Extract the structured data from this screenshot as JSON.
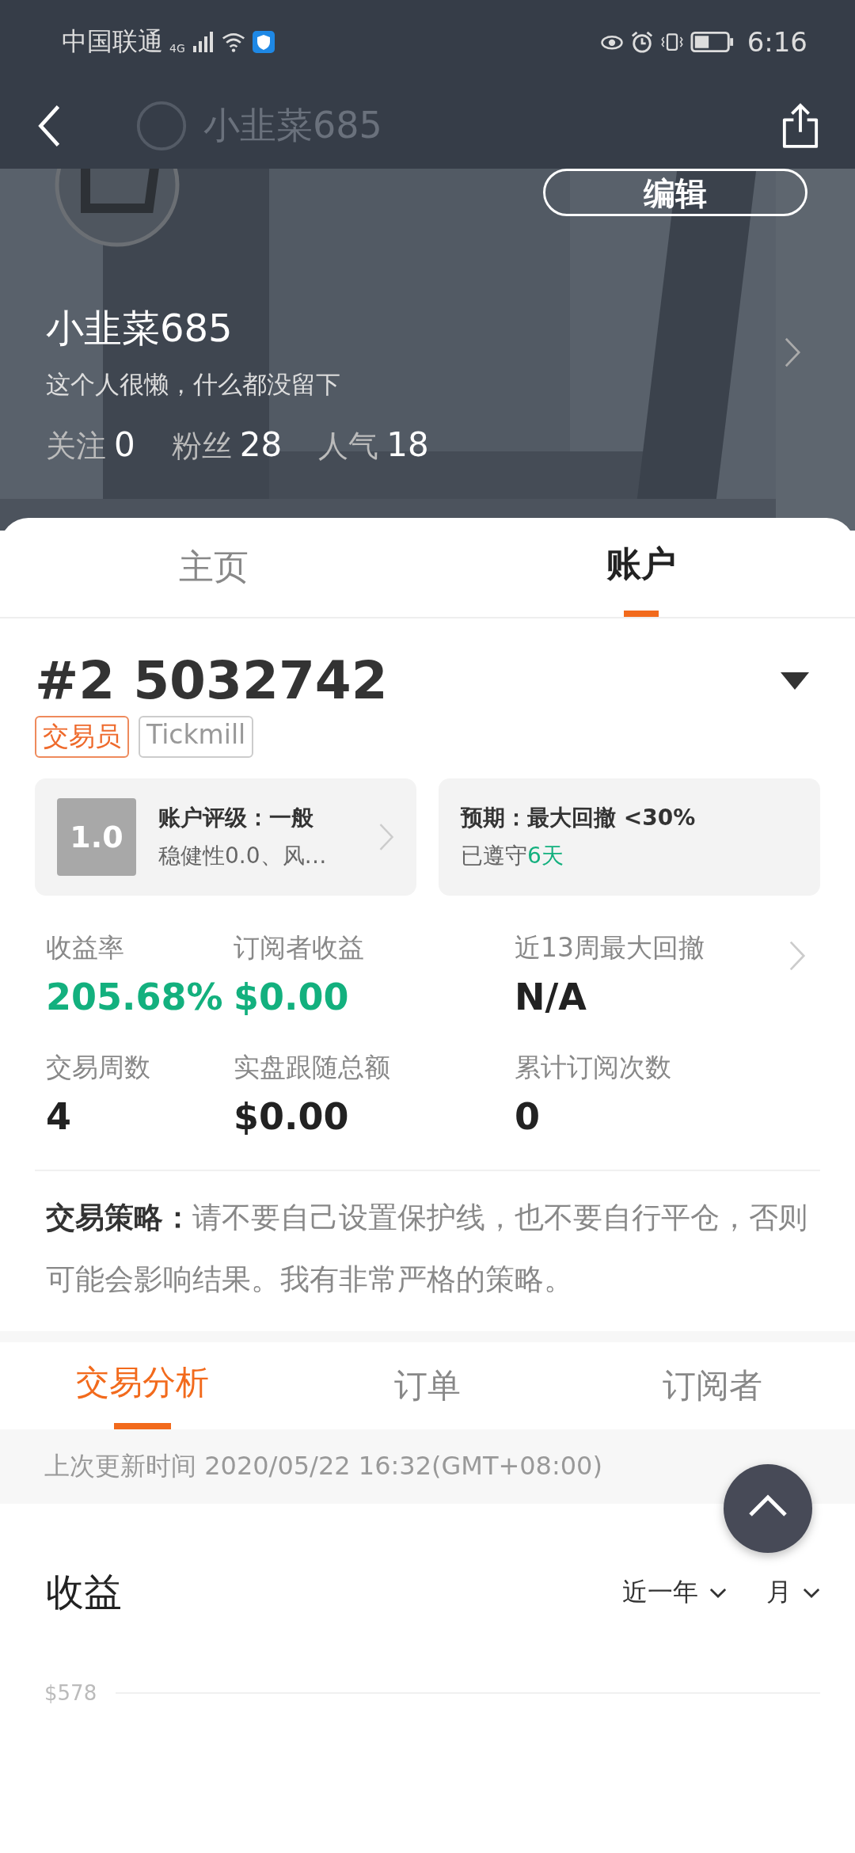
{
  "status_bar": {
    "carrier": "中国联通",
    "network": "4G",
    "time": "6:16"
  },
  "nav": {
    "title": "小韭菜685"
  },
  "profile": {
    "edit_button": "编辑",
    "name": "小韭菜685",
    "bio": "这个人很懒，什么都没留下",
    "stats": [
      {
        "label": "关注",
        "value": "0"
      },
      {
        "label": "粉丝",
        "value": "28"
      },
      {
        "label": "人气",
        "value": "18"
      }
    ]
  },
  "tabs": [
    {
      "label": "主页",
      "selected": false
    },
    {
      "label": "账户",
      "selected": true
    }
  ],
  "account": {
    "number": "#2 5032742",
    "tags": [
      {
        "label": "交易员",
        "kind": "role"
      },
      {
        "label": "Tickmill",
        "kind": "broker"
      }
    ],
    "rating_card": {
      "score": "1.0",
      "title": "账户评级：一般",
      "detail": "稳健性0.0、风…"
    },
    "expectation_card": {
      "title": "预期：最大回撤 <30%",
      "detail_prefix": "已遵守",
      "detail_highlight": "6天"
    },
    "metrics": [
      {
        "label": "收益率",
        "value": "205.68%",
        "color": "#13b07e"
      },
      {
        "label": "订阅者收益",
        "value": "$0.00",
        "color": "#13b07e"
      },
      {
        "label": "近13周最大回撤",
        "value": "N/A",
        "color": "#222222"
      },
      {
        "label": "交易周数",
        "value": "4",
        "color": "#222222"
      },
      {
        "label": "实盘跟随总额",
        "value": "$0.00",
        "color": "#222222"
      },
      {
        "label": "累计订阅次数",
        "value": "0",
        "color": "#222222"
      }
    ],
    "strategy": "**交易策略：**请不要自己设置保护线，也不要自行平仓，否则可能会影响结果。我有非常严格的策略。"
  },
  "sub_tabs": [
    {
      "label": "交易分析",
      "selected": true
    },
    {
      "label": "订单",
      "selected": false
    },
    {
      "label": "订阅者",
      "selected": false
    }
  ],
  "update_time": "上次更新时间 2020/05/22 16:32(GMT+08:00)",
  "earnings": {
    "title": "收益",
    "filters": [
      "近一年",
      "月"
    ],
    "axis_label": "$578"
  }
}
